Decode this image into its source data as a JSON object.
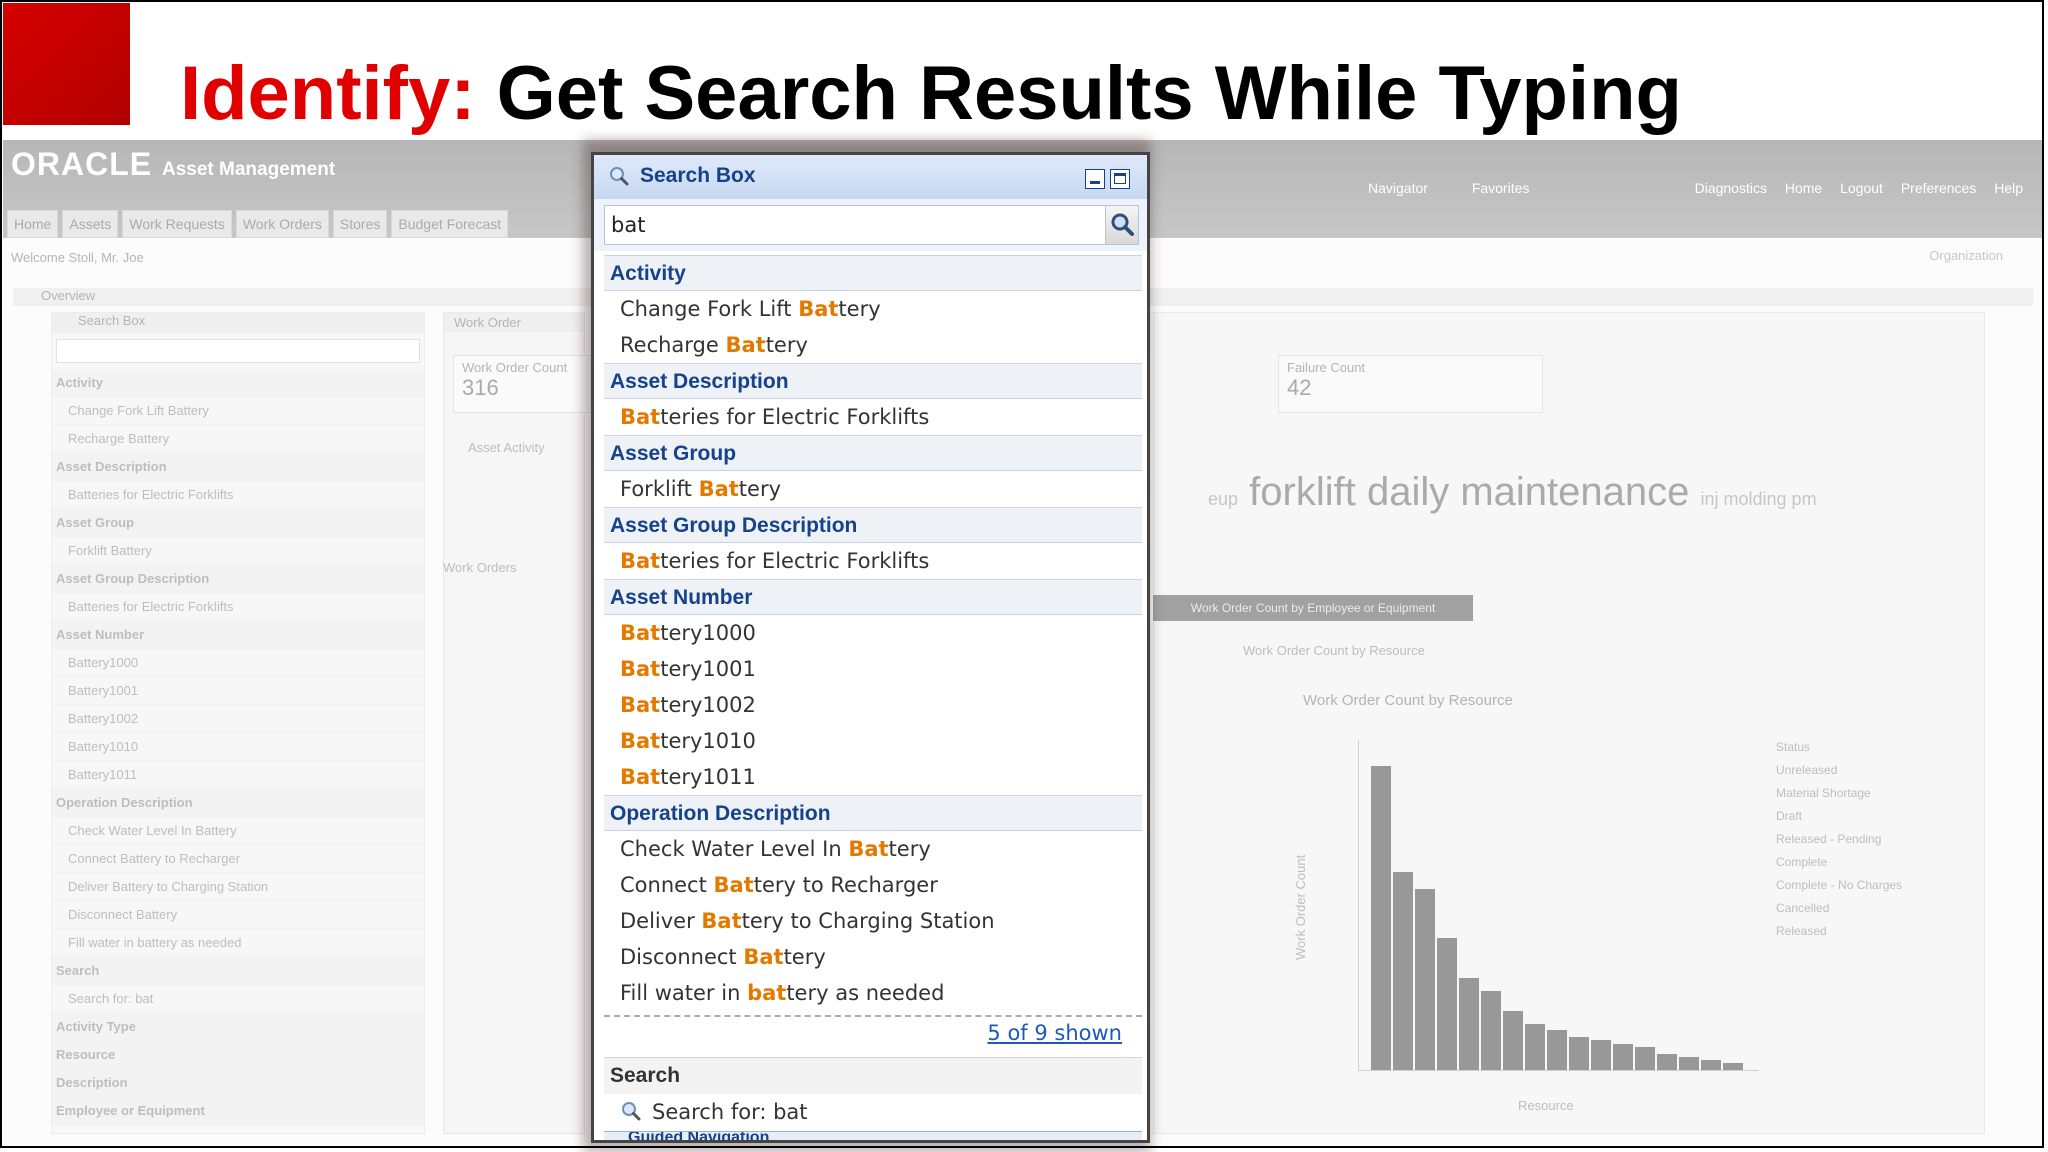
{
  "slide": {
    "title_prefix": "Identify:",
    "title_rest": "Get Search Results While Typing"
  },
  "background_app": {
    "brand": "ORACLE",
    "product": "Asset Management",
    "nav_menus": [
      "Navigator",
      "Favorites"
    ],
    "header_links": [
      "Diagnostics",
      "Home",
      "Logout",
      "Preferences",
      "Help"
    ],
    "tabs": [
      "Home",
      "Assets",
      "Work Requests",
      "Work Orders",
      "Stores",
      "Budget Forecast"
    ],
    "welcome": "Welcome Stoll, Mr. Joe",
    "organization_label": "Organization",
    "overview_label": "Overview",
    "work_order_panel": "Work Order",
    "work_order_count_label": "Work Order Count",
    "work_order_count": "316",
    "failure_count_label": "Failure Count",
    "failure_count": "42",
    "asset_activity_label": "Asset Activity",
    "cloud_text": "forklift daily maintenance",
    "cloud_small_left": "eup",
    "cloud_small": "inj molding pm",
    "work_orders_label": "Work Orders",
    "chart_tab": "Work Order Count by Employee or Equipment",
    "chart_panel": "Work Order Count by Resource",
    "chart_title": "Work Order Count by Resource",
    "chart_ylabel": "Work Order Count",
    "chart_xlabel": "Resource",
    "legend_title": "Status",
    "legend_items": [
      "Unreleased",
      "Material Shortage",
      "Draft",
      "Released - Pending",
      "Complete",
      "Complete - No Charges",
      "Cancelled",
      "Released"
    ],
    "sidebar_lines": [
      {
        "t": "Search Box",
        "k": "h"
      },
      {
        "t": "Activity",
        "k": "g"
      },
      {
        "t": "Change Fork Lift Battery",
        "k": "i"
      },
      {
        "t": "Recharge Battery",
        "k": "i"
      },
      {
        "t": "Asset Description",
        "k": "g"
      },
      {
        "t": "Batteries for Electric Forklifts",
        "k": "i"
      },
      {
        "t": "Asset Group",
        "k": "g"
      },
      {
        "t": "Forklift Battery",
        "k": "i"
      },
      {
        "t": "Asset Group Description",
        "k": "g"
      },
      {
        "t": "Batteries for Electric Forklifts",
        "k": "i"
      },
      {
        "t": "Asset Number",
        "k": "g"
      },
      {
        "t": "Battery1000",
        "k": "i"
      },
      {
        "t": "Battery1001",
        "k": "i"
      },
      {
        "t": "Battery1002",
        "k": "i"
      },
      {
        "t": "Battery1010",
        "k": "i"
      },
      {
        "t": "Battery1011",
        "k": "i"
      },
      {
        "t": "Operation Description",
        "k": "g"
      },
      {
        "t": "Check Water Level In Battery",
        "k": "i"
      },
      {
        "t": "Connect Battery to Recharger",
        "k": "i"
      },
      {
        "t": "Deliver Battery to Charging Station",
        "k": "i"
      },
      {
        "t": "Disconnect Battery",
        "k": "i"
      },
      {
        "t": "Fill water in battery as needed",
        "k": "i"
      },
      {
        "t": "Search",
        "k": "g"
      },
      {
        "t": "Search for: bat",
        "k": "i"
      },
      {
        "t": "Activity Type",
        "k": "g"
      },
      {
        "t": "Resource",
        "k": "g"
      },
      {
        "t": "Description",
        "k": "g"
      },
      {
        "t": "Employee or Equipment",
        "k": "g"
      }
    ],
    "bar_heights_pct": [
      92,
      60,
      55,
      40,
      28,
      24,
      18,
      14,
      12,
      10,
      9,
      8,
      7,
      5,
      4,
      3,
      2
    ]
  },
  "search_box": {
    "title": "Search Box",
    "query": "bat",
    "groups": [
      {
        "label": "Activity",
        "items": [
          {
            "pre": "Change Fork Lift ",
            "hl": "Bat",
            "post": "tery"
          },
          {
            "pre": "Recharge ",
            "hl": "Bat",
            "post": "tery"
          }
        ]
      },
      {
        "label": "Asset Description",
        "items": [
          {
            "pre": "",
            "hl": "Bat",
            "post": "teries for Electric Forklifts"
          }
        ]
      },
      {
        "label": "Asset Group",
        "items": [
          {
            "pre": "Forklift ",
            "hl": "Bat",
            "post": "tery"
          }
        ]
      },
      {
        "label": "Asset Group Description",
        "items": [
          {
            "pre": "",
            "hl": "Bat",
            "post": "teries for Electric Forklifts"
          }
        ]
      },
      {
        "label": "Asset Number",
        "items": [
          {
            "pre": "",
            "hl": "Bat",
            "post": "tery1000"
          },
          {
            "pre": "",
            "hl": "Bat",
            "post": "tery1001"
          },
          {
            "pre": "",
            "hl": "Bat",
            "post": "tery1002"
          },
          {
            "pre": "",
            "hl": "Bat",
            "post": "tery1010"
          },
          {
            "pre": "",
            "hl": "Bat",
            "post": "tery1011"
          }
        ]
      },
      {
        "label": "Operation Description",
        "items": [
          {
            "pre": "Check Water Level In ",
            "hl": "Bat",
            "post": "tery"
          },
          {
            "pre": "Connect ",
            "hl": "Bat",
            "post": "tery to Recharger"
          },
          {
            "pre": "Deliver ",
            "hl": "Bat",
            "post": "tery to Charging Station"
          },
          {
            "pre": "Disconnect ",
            "hl": "Bat",
            "post": "tery"
          },
          {
            "pre": "Fill water in ",
            "hl": "bat",
            "post": "tery as needed"
          }
        ]
      }
    ],
    "shown_text": "5 of 9 shown",
    "search_label": "Search",
    "search_for_text": "Search for: bat",
    "next_section_partial": "Guided Navigation"
  },
  "colors": {
    "title_red": "#e00000",
    "highlight": "#e37a00",
    "header_blue": "#15428b",
    "link_blue": "#1d59b8"
  }
}
